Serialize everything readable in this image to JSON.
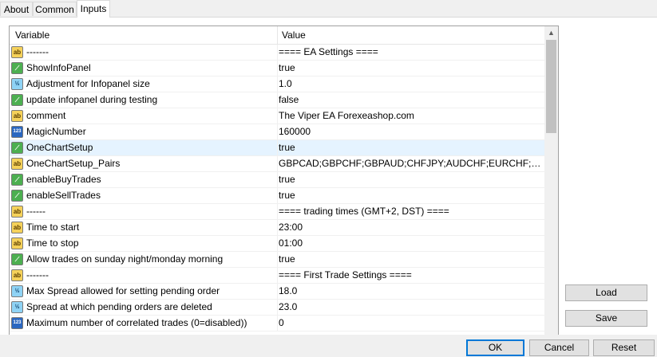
{
  "tabs": [
    {
      "label": "About"
    },
    {
      "label": "Common"
    },
    {
      "label": "Inputs"
    }
  ],
  "columns": {
    "variable": "Variable",
    "value": "Value"
  },
  "rows": [
    {
      "icon": "string-icon",
      "glyph": "ab",
      "type": "str",
      "name": "-------",
      "value": "==== EA Settings ===="
    },
    {
      "icon": "bool-icon",
      "glyph": "⟋",
      "type": "bool",
      "name": "ShowInfoPanel",
      "value": "true"
    },
    {
      "icon": "double-icon",
      "glyph": "½",
      "type": "dbl",
      "name": "Adjustment for Infopanel size",
      "value": "1.0"
    },
    {
      "icon": "bool-icon",
      "glyph": "⟋",
      "type": "bool",
      "name": "update infopanel during testing",
      "value": "false"
    },
    {
      "icon": "string-icon",
      "glyph": "ab",
      "type": "str",
      "name": "comment",
      "value": "The Viper EA Forexeashop.com"
    },
    {
      "icon": "int-icon",
      "glyph": "123",
      "type": "int",
      "name": "MagicNumber",
      "value": "160000"
    },
    {
      "icon": "bool-icon",
      "glyph": "⟋",
      "type": "bool",
      "name": "OneChartSetup",
      "value": "true"
    },
    {
      "icon": "string-icon",
      "glyph": "ab",
      "type": "str",
      "name": "OneChartSetup_Pairs",
      "value": "GBPCAD;GBPCHF;GBPAUD;CHFJPY;AUDCHF;EURCHF;EURUS..."
    },
    {
      "icon": "bool-icon",
      "glyph": "⟋",
      "type": "bool",
      "name": "enableBuyTrades",
      "value": "true"
    },
    {
      "icon": "bool-icon",
      "glyph": "⟋",
      "type": "bool",
      "name": "enableSellTrades",
      "value": "true"
    },
    {
      "icon": "string-icon",
      "glyph": "ab",
      "type": "str",
      "name": "------",
      "value": "==== trading times (GMT+2, DST) ===="
    },
    {
      "icon": "string-icon",
      "glyph": "ab",
      "type": "str",
      "name": "Time to start",
      "value": "23:00"
    },
    {
      "icon": "string-icon",
      "glyph": "ab",
      "type": "str",
      "name": "Time to stop",
      "value": "01:00"
    },
    {
      "icon": "bool-icon",
      "glyph": "⟋",
      "type": "bool",
      "name": "Allow trades on sunday night/monday morning",
      "value": "true"
    },
    {
      "icon": "string-icon",
      "glyph": "ab",
      "type": "str",
      "name": "-------",
      "value": "==== First Trade Settings ===="
    },
    {
      "icon": "double-icon",
      "glyph": "½",
      "type": "dbl",
      "name": "Max Spread allowed for setting pending order",
      "value": "18.0"
    },
    {
      "icon": "double-icon",
      "glyph": "½",
      "type": "dbl",
      "name": "Spread at which pending orders are deleted",
      "value": "23.0"
    },
    {
      "icon": "int-icon",
      "glyph": "123",
      "type": "int",
      "name": "Maximum number of correlated trades (0=disabled))",
      "value": "0"
    }
  ],
  "selected_row": 6,
  "side_buttons": {
    "load": "Load",
    "save": "Save"
  },
  "footer_buttons": {
    "ok": "OK",
    "cancel": "Cancel",
    "reset": "Reset"
  },
  "colors": {
    "selection": "#e5f3ff",
    "accent": "#0078d7"
  }
}
